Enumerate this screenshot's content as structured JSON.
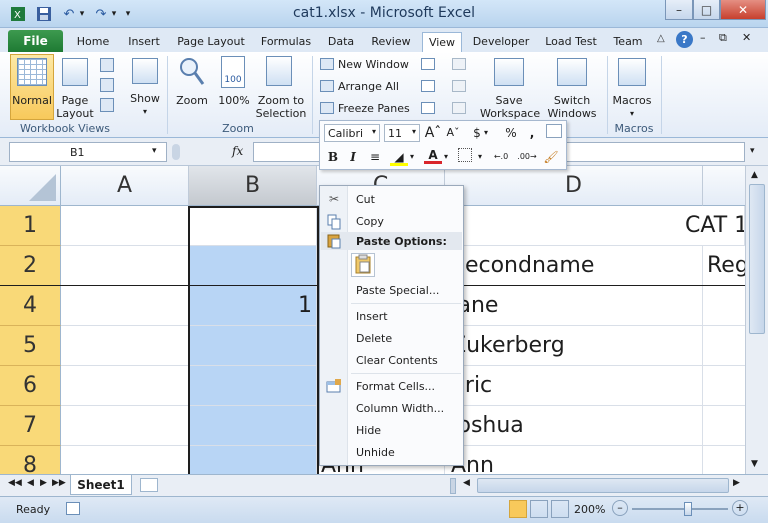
{
  "window": {
    "title": "cat1.xlsx - Microsoft Excel",
    "minimize": "–",
    "restore": "□",
    "close": "✕"
  },
  "qat": {
    "dropdown": "▾"
  },
  "tabs": {
    "file": "File",
    "home": "Home",
    "insert": "Insert",
    "page_layout": "Page Layout",
    "formulas": "Formulas",
    "data": "Data",
    "review": "Review",
    "view": "View",
    "developer": "Developer",
    "load_test": "Load Test",
    "team": "Team"
  },
  "ribbon": {
    "normal": "Normal",
    "page_layout": "Page Layout",
    "show": "Show",
    "zoom": "Zoom",
    "zoom100": "100%",
    "zoom_sel": "Zoom to Selection",
    "new_window": "New Window",
    "arrange_all": "Arrange All",
    "freeze_panes": "Freeze Panes",
    "save_ws": "Save Workspace",
    "switch_win": "Switch Windows",
    "macros": "Macros",
    "grp_workbook_views": "Workbook Views",
    "grp_zoom": "Zoom",
    "grp_macros": "Macros"
  },
  "formula_bar": {
    "name_box": "B1",
    "fx": "fx",
    "formula": ""
  },
  "columns": [
    "A",
    "B",
    "C",
    "D"
  ],
  "rows": [
    "1",
    "2",
    "4",
    "5",
    "6",
    "7",
    "8"
  ],
  "cells": {
    "d1": "CAT 1",
    "d2": "Secondname",
    "e2": "Reg",
    "b4": "1",
    "d4": "Jane",
    "d5": "Zukerberg",
    "d6": "Eric",
    "d7": "Joshua",
    "c8": "Ann",
    "d8": "Ann"
  },
  "mini_toolbar": {
    "font": "Calibri",
    "size": "11",
    "bold": "B",
    "italic": "I",
    "currency": "$",
    "percent": "%",
    "comma": ","
  },
  "context_menu": {
    "cut": "Cut",
    "copy": "Copy",
    "paste_options": "Paste Options:",
    "paste_special": "Paste Special...",
    "insert": "Insert",
    "delete": "Delete",
    "clear": "Clear Contents",
    "format_cells": "Format Cells...",
    "col_width": "Column Width...",
    "hide": "Hide",
    "unhide": "Unhide"
  },
  "sheet": {
    "tab": "Sheet1"
  },
  "status": {
    "ready": "Ready",
    "zoom": "200%",
    "minus": "–",
    "plus": "+"
  }
}
